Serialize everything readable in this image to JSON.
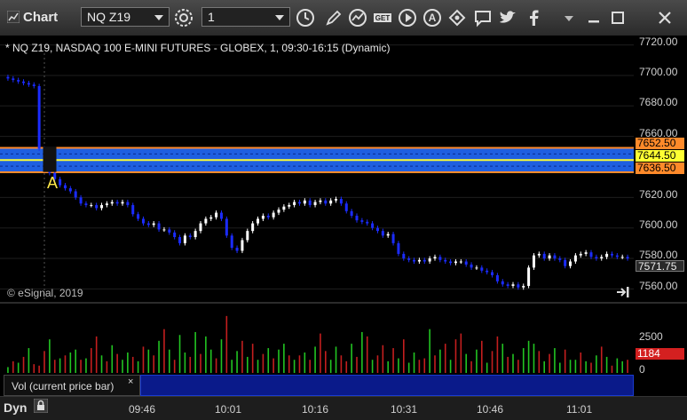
{
  "toolbar": {
    "app_title": "Chart",
    "symbol_value": "NQ Z19",
    "interval_value": "1",
    "icons": [
      "chart-settings-icon",
      "clock-icon",
      "draw-pencil-icon",
      "study-icon",
      "get-icon",
      "play-icon",
      "alert-icon",
      "link-icon",
      "comment-icon",
      "twitter-icon",
      "facebook-icon"
    ]
  },
  "chart": {
    "title": "* NQ Z19, NASDAQ 100 E-MINI FUTURES - GLOBEX, 1, 09:30-16:15 (Dynamic)",
    "copyright": "© eSignal, 2019",
    "marker": "A",
    "price_ticks": [
      "7720.00",
      "7700.00",
      "7680.00",
      "7660.00",
      "7640.00",
      "7620.00",
      "7600.00",
      "7580.00",
      "7560.00"
    ],
    "zone_labels": {
      "upper": "7652.50",
      "mid": "7644.50",
      "lower": "7636.50",
      "last": "7571.75"
    },
    "colors": {
      "zone": "#1f5fe0",
      "zone_border": "#ff8a2a",
      "midline": "#ffff33",
      "candle_up": "#ffffff",
      "candle_down": "#1b2cff",
      "vol_up": "#22c422",
      "vol_down": "#c41e1e"
    }
  },
  "chart_data": {
    "type": "candlestick",
    "ylim": [
      7555,
      7725
    ],
    "x_ticks": [
      "09:46",
      "10:01",
      "10:16",
      "10:31",
      "10:46",
      "11:01"
    ],
    "close_series": [
      7698,
      7697,
      7696,
      7695,
      7694,
      7693,
      7652,
      7640,
      7636,
      7632,
      7628,
      7626,
      7624,
      7620,
      7616,
      7615,
      7615,
      7613,
      7615,
      7616,
      7617,
      7616,
      7617,
      7615,
      7609,
      7606,
      7603,
      7602,
      7603,
      7599,
      7599,
      7597,
      7594,
      7590,
      7595,
      7594,
      7598,
      7603,
      7606,
      7607,
      7610,
      7606,
      7595,
      7587,
      7585,
      7592,
      7598,
      7603,
      7606,
      7608,
      7607,
      7610,
      7612,
      7614,
      7615,
      7617,
      7616,
      7618,
      7615,
      7617,
      7618,
      7616,
      7618,
      7619,
      7616,
      7611,
      7608,
      7605,
      7604,
      7603,
      7600,
      7598,
      7595,
      7596,
      7590,
      7583,
      7580,
      7579,
      7578,
      7579,
      7578,
      7580,
      7581,
      7579,
      7578,
      7577,
      7578,
      7578,
      7576,
      7574,
      7574,
      7572,
      7571,
      7569,
      7565,
      7563,
      7562,
      7563,
      7561,
      7562,
      7574,
      7582,
      7583,
      7580,
      7582,
      7580,
      7579,
      7575,
      7578,
      7582,
      7583,
      7584,
      7581,
      7580,
      7581,
      7583,
      7582,
      7581,
      7581,
      7580
    ],
    "levels": [
      7652.5,
      7644.5,
      7636.5
    ],
    "volume": {
      "yticks": [
        "2500",
        "0"
      ],
      "ylim": [
        0,
        4500
      ],
      "last": "1184",
      "values": [
        400,
        800,
        700,
        1100,
        1700,
        600,
        500,
        1500,
        2300,
        900,
        1000,
        1200,
        1400,
        1600,
        900,
        1000,
        1700,
        2500,
        1200,
        800,
        1900,
        1300,
        900,
        1400,
        1100,
        800,
        1800,
        1600,
        1200,
        2200,
        3000,
        1600,
        900,
        2600,
        1400,
        1100,
        2800,
        1300,
        2500,
        1600,
        1000,
        2300,
        3900,
        900,
        1500,
        2200,
        1100,
        2000,
        900,
        1300,
        1700,
        1000,
        1600,
        2000,
        1200,
        900,
        1200,
        1400,
        900,
        1800,
        2700,
        1500,
        900,
        1800,
        1200,
        800,
        2000,
        1100,
        2800,
        2500,
        900,
        1200,
        1900,
        800,
        1700,
        1000,
        2300,
        700,
        1400,
        900,
        1000,
        3000,
        1200,
        1600,
        2000,
        900,
        2300,
        2700,
        1300,
        800,
        1600,
        2200,
        700,
        1500,
        2500,
        2000,
        1100,
        1300,
        900,
        1700,
        2200,
        2000,
        1500,
        800,
        1300,
        1700,
        700,
        1600,
        900,
        900,
        1400,
        800,
        700,
        1200,
        1800,
        1100,
        500,
        1000,
        800,
        900
      ],
      "up": [
        1,
        0,
        1,
        0,
        1,
        0,
        0,
        0,
        1,
        0,
        1,
        0,
        1,
        1,
        0,
        1,
        0,
        0,
        1,
        0,
        1,
        0,
        1,
        1,
        0,
        1,
        0,
        1,
        0,
        1,
        0,
        1,
        0,
        1,
        1,
        0,
        1,
        0,
        1,
        1,
        0,
        1,
        0,
        1,
        1,
        0,
        1,
        0,
        1,
        0,
        1,
        0,
        1,
        1,
        0,
        1,
        0,
        1,
        0,
        1,
        0,
        0,
        1,
        1,
        0,
        0,
        1,
        0,
        1,
        0,
        1,
        0,
        0,
        1,
        0,
        1,
        0,
        1,
        1,
        0,
        0,
        1,
        0,
        1,
        0,
        1,
        0,
        0,
        1,
        0,
        1,
        0,
        1,
        0,
        0,
        1,
        0,
        1,
        0,
        1,
        1,
        1,
        0,
        1,
        0,
        1,
        1,
        0,
        1,
        1,
        0,
        1,
        0,
        1,
        0,
        1,
        0,
        1,
        1,
        0
      ]
    }
  },
  "volume_panel": {
    "label": "Vol (current price bar)",
    "close": "×"
  },
  "bottom": {
    "dyn": "Dyn"
  }
}
